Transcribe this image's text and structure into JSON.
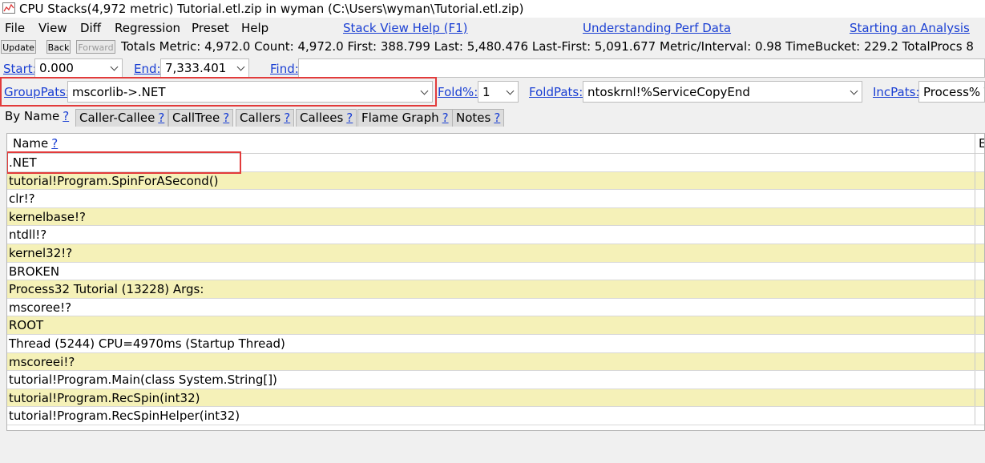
{
  "window": {
    "title": "CPU Stacks(4,972 metric) Tutorial.etl.zip in wyman (C:\\Users\\wyman\\Tutorial.etl.zip)"
  },
  "menu": {
    "items": [
      "File",
      "View",
      "Diff",
      "Regression",
      "Preset",
      "Help"
    ],
    "links": [
      "Stack View Help (F1)",
      "Understanding Perf Data",
      "Starting an Analysis"
    ]
  },
  "toolbar": {
    "update_label": "Update",
    "back_label": "Back",
    "forward_label": "Forward",
    "totals_text": "Totals Metric: 4,972.0  Count: 4,972.0  First: 388.799 Last: 5,480.476  Last-First: 5,091.677  Metric/Interval: 0.98  TimeBucket: 229.2  TotalProcs 8"
  },
  "range": {
    "start_label": "Start:",
    "start_value": "0.000",
    "end_label": "End:",
    "end_value": "7,333.401",
    "find_label": "Find:",
    "find_value": ""
  },
  "filters": {
    "grouppats_label": "GroupPats:",
    "grouppats_value": "mscorlib->.NET",
    "fold_label": "Fold%:",
    "fold_value": "1",
    "foldpats_label": "FoldPats:",
    "foldpats_value": "ntoskrnl!%ServiceCopyEnd",
    "incpats_label": "IncPats:",
    "incpats_value": "Process% T"
  },
  "tabs": [
    {
      "label": "By Name",
      "q": "?"
    },
    {
      "label": "Caller-Callee",
      "q": "?"
    },
    {
      "label": "CallTree",
      "q": "?"
    },
    {
      "label": "Callers",
      "q": "?"
    },
    {
      "label": "Callees",
      "q": "?"
    },
    {
      "label": "Flame Graph",
      "q": "?"
    },
    {
      "label": "Notes",
      "q": "?"
    }
  ],
  "grid": {
    "header_name": "Name",
    "header_q": "?",
    "header_next": "E",
    "rows": [
      ".NET",
      "tutorial!Program.SpinForASecond()",
      "clr!?",
      "kernelbase!?",
      "ntdll!?",
      "kernel32!?",
      "BROKEN",
      "Process32 Tutorial (13228) Args:",
      "mscoree!?",
      "ROOT",
      "Thread (5244) CPU=4970ms (Startup Thread)",
      "mscoreei!?",
      "tutorial!Program.Main(class System.String[])",
      "tutorial!Program.RecSpin(int32)",
      "tutorial!Program.RecSpinHelper(int32)"
    ]
  },
  "colors": {
    "link": "#1a3fd3",
    "highlight_box": "#e23b3b",
    "alt_row": "#f5f1b8"
  }
}
